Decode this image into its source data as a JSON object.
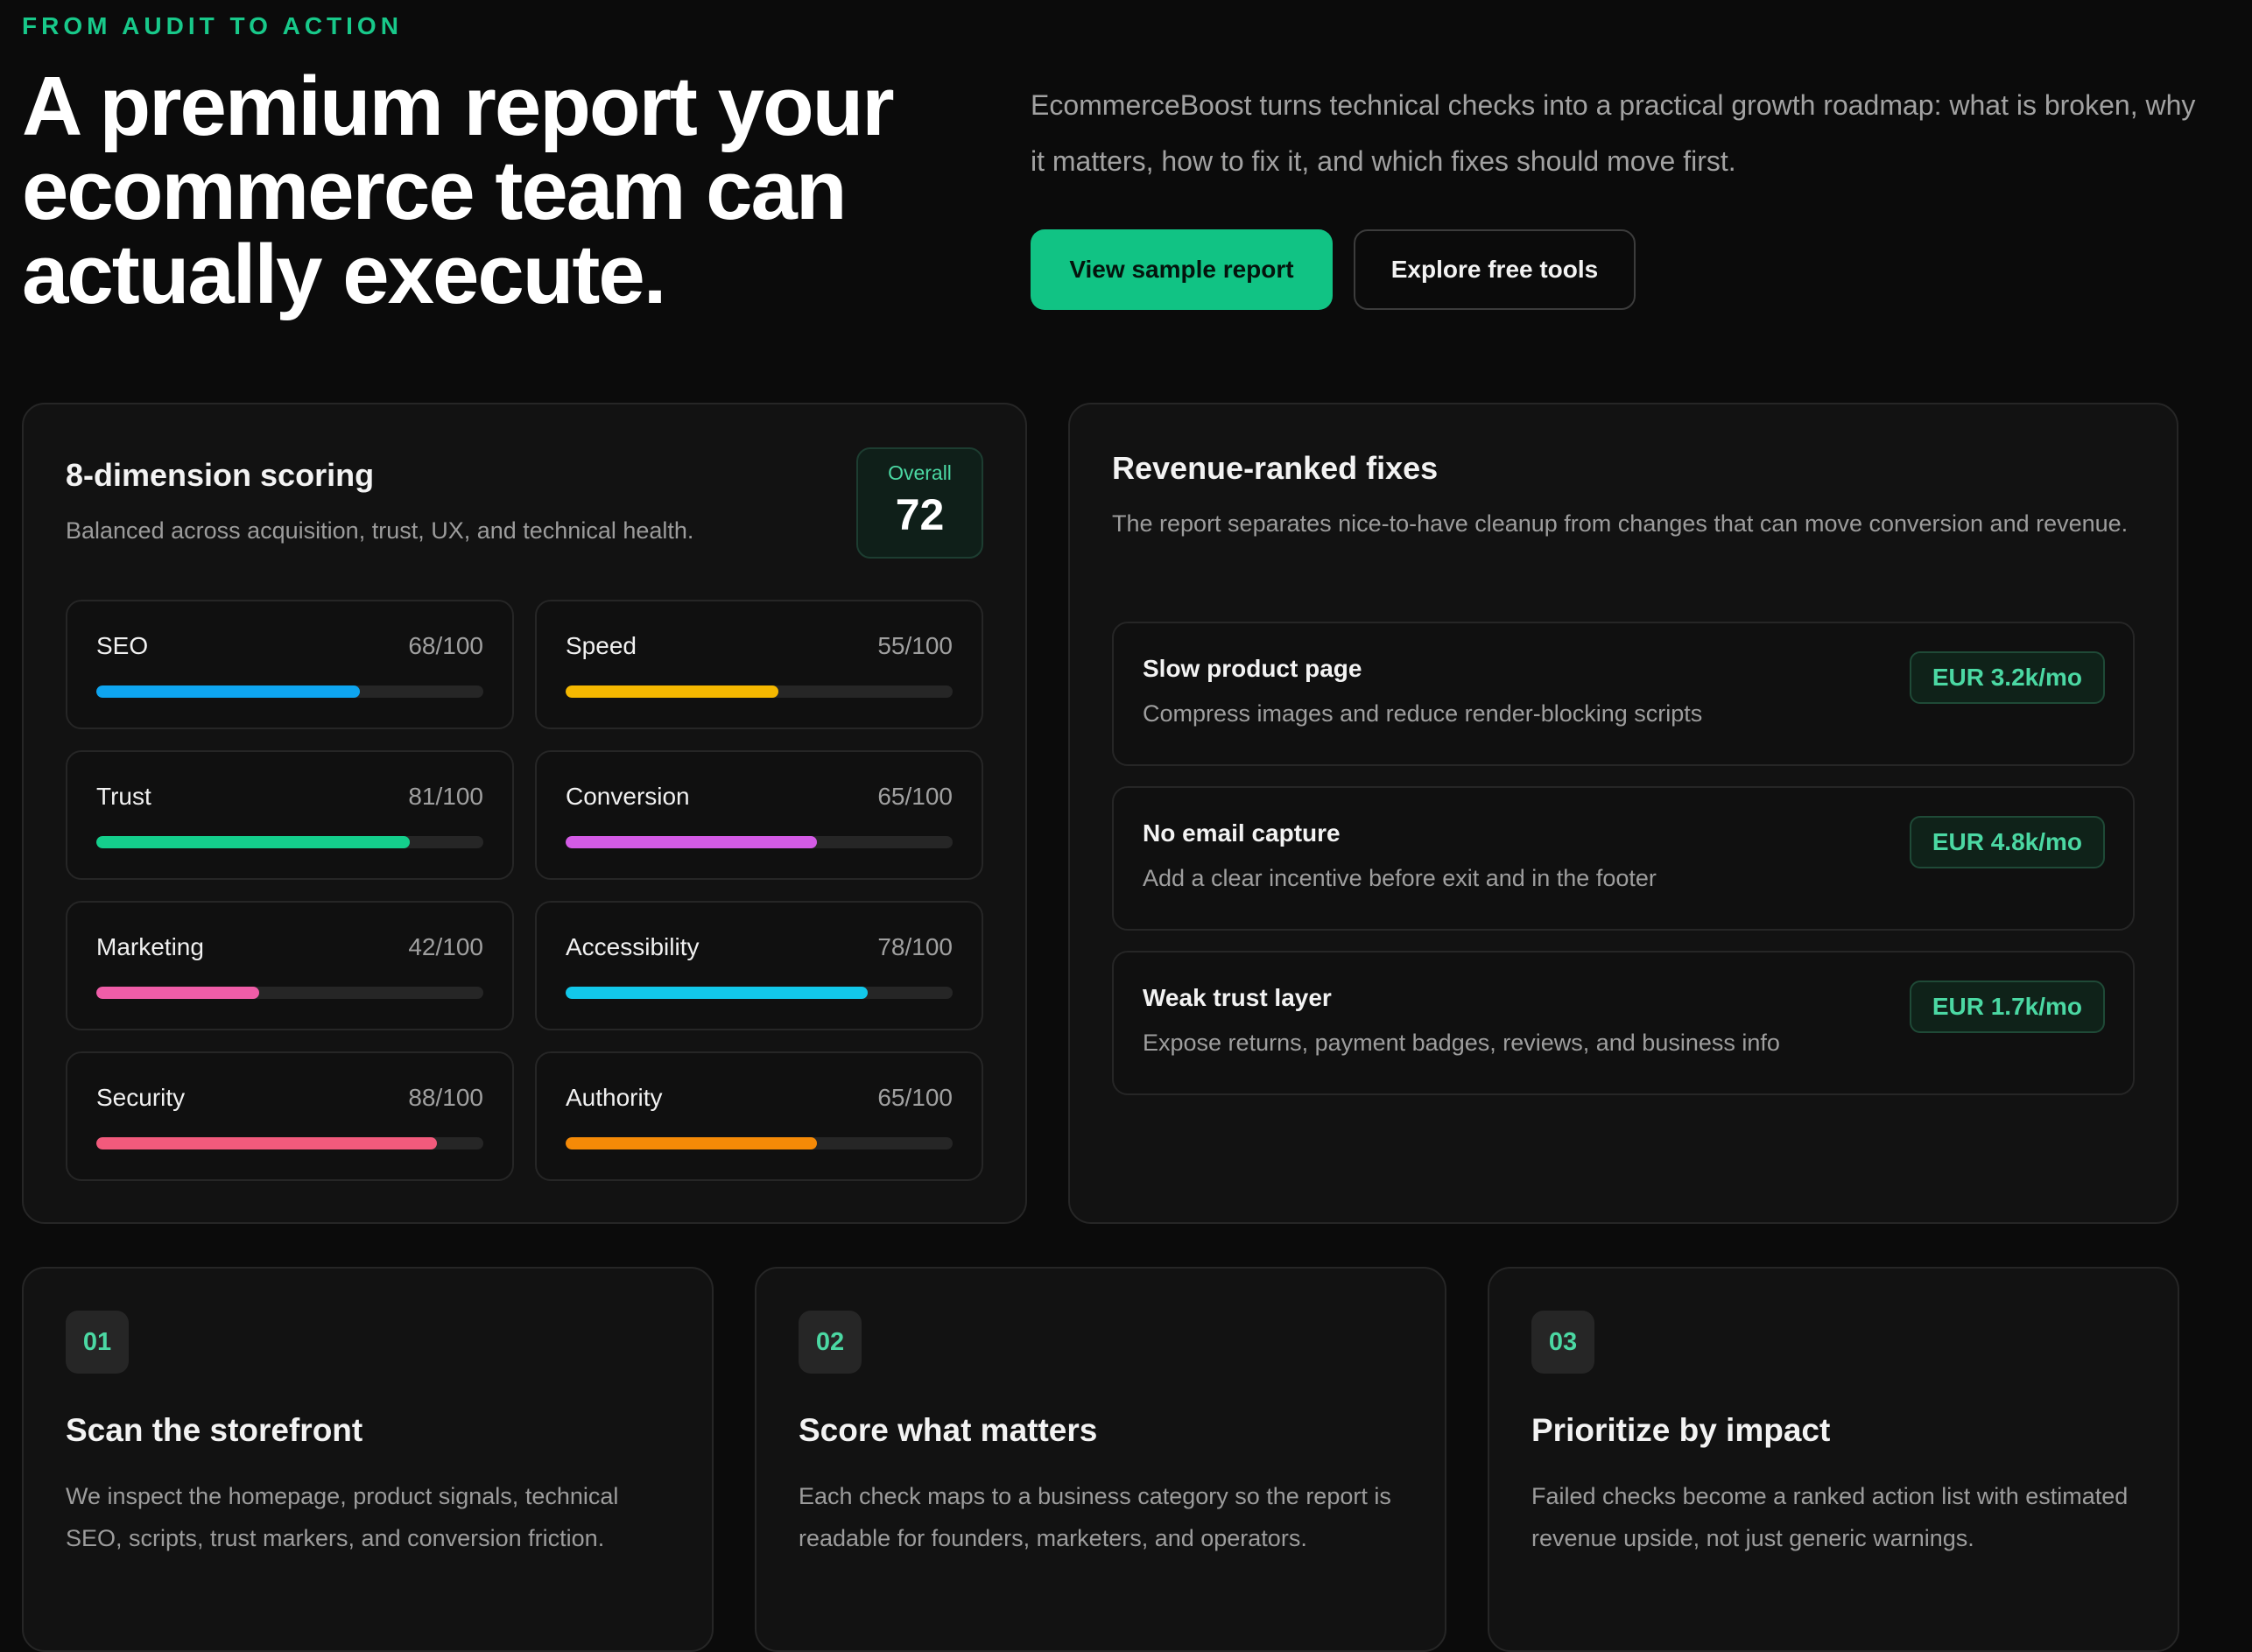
{
  "hero": {
    "eyebrow": "FROM AUDIT TO ACTION",
    "title": "A premium report your ecommerce team can actually execute.",
    "description": "EcommerceBoost turns technical checks into a practical growth roadmap: what is broken, why it matters, how to fix it, and which fixes should move first.",
    "primary_button": "View sample report",
    "secondary_button": "Explore free tools"
  },
  "scoring": {
    "title": "8-dimension scoring",
    "subtitle": "Balanced across acquisition, trust, UX, and technical health.",
    "overall_label": "Overall",
    "overall_value": "72",
    "metrics": [
      {
        "name": "SEO",
        "score": "68/100",
        "value": 68,
        "color": "#0ea5f0"
      },
      {
        "name": "Speed",
        "score": "55/100",
        "value": 55,
        "color": "#f5b800"
      },
      {
        "name": "Trust",
        "score": "81/100",
        "value": 81,
        "color": "#14cf8c"
      },
      {
        "name": "Conversion",
        "score": "65/100",
        "value": 65,
        "color": "#d45be6"
      },
      {
        "name": "Marketing",
        "score": "42/100",
        "value": 42,
        "color": "#ef5da8"
      },
      {
        "name": "Accessibility",
        "score": "78/100",
        "value": 78,
        "color": "#12c8ea"
      },
      {
        "name": "Security",
        "score": "88/100",
        "value": 88,
        "color": "#f25a7c"
      },
      {
        "name": "Authority",
        "score": "65/100",
        "value": 65,
        "color": "#f58a07"
      }
    ]
  },
  "fixes": {
    "title": "Revenue-ranked fixes",
    "subtitle": "The report separates nice-to-have cleanup from changes that can move conversion and revenue.",
    "items": [
      {
        "title": "Slow product page",
        "description": "Compress images and reduce render-blocking scripts",
        "value": "EUR 3.2k/mo"
      },
      {
        "title": "No email capture",
        "description": "Add a clear incentive before exit and in the footer",
        "value": "EUR 4.8k/mo"
      },
      {
        "title": "Weak trust layer",
        "description": "Expose returns, payment badges, reviews, and business info",
        "value": "EUR 1.7k/mo"
      }
    ]
  },
  "steps": [
    {
      "number": "01",
      "title": "Scan the storefront",
      "description": "We inspect the homepage, product signals, technical SEO, scripts, trust markers, and conversion friction."
    },
    {
      "number": "02",
      "title": "Score what matters",
      "description": "Each check maps to a business category so the report is readable for founders, marketers, and operators."
    },
    {
      "number": "03",
      "title": "Prioritize by impact",
      "description": "Failed checks become a ranked action list with estimated revenue upside, not just generic warnings."
    }
  ]
}
